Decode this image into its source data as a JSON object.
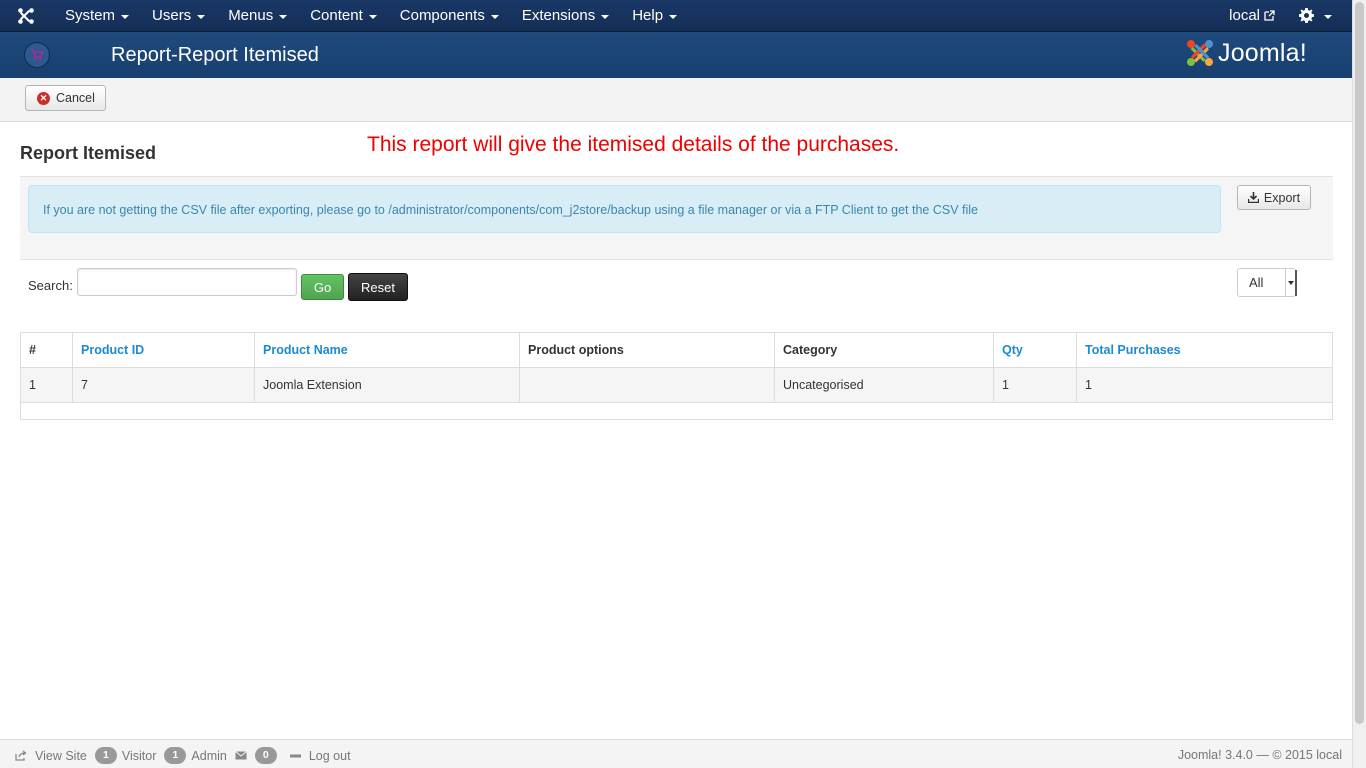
{
  "navbar": {
    "menu": [
      {
        "label": "System"
      },
      {
        "label": "Users"
      },
      {
        "label": "Menus"
      },
      {
        "label": "Content"
      },
      {
        "label": "Components"
      },
      {
        "label": "Extensions"
      },
      {
        "label": "Help"
      }
    ],
    "site_link": "local"
  },
  "header": {
    "title": "Report-Report Itemised",
    "brand": "Joomla!"
  },
  "toolbar": {
    "cancel_label": "Cancel"
  },
  "content": {
    "heading": "Report Itemised",
    "notice": "This report will give the itemised details of the purchases.",
    "info_message": "If you are not getting the CSV file after exporting, please go to /administrator/components/com_j2store/backup using a file manager or via a FTP Client to get the CSV file",
    "export_label": "Export",
    "search_label": "Search:",
    "search_value": "",
    "go_label": "Go",
    "reset_label": "Reset",
    "limit_selected": "All"
  },
  "table": {
    "columns": [
      "#",
      "Product ID",
      "Product Name",
      "Product options",
      "Category",
      "Qty",
      "Total Purchases"
    ],
    "rows": [
      [
        "1",
        "7",
        "Joomla Extension",
        "",
        "Uncategorised",
        "1",
        "1"
      ]
    ]
  },
  "statusbar": {
    "view_site": "View Site",
    "visitor_count": "1",
    "visitor_label": "Visitor",
    "admin_count": "1",
    "admin_label": "Admin",
    "messages_count": "0",
    "logout": "Log out",
    "version": "Joomla! 3.4.0  —  © 2015 local"
  },
  "colors": {
    "navbar": "#17365d",
    "header": "#1f4a7c",
    "notice": "#ee0000",
    "link": "#1a8ad4",
    "go_button": "#51a351"
  }
}
